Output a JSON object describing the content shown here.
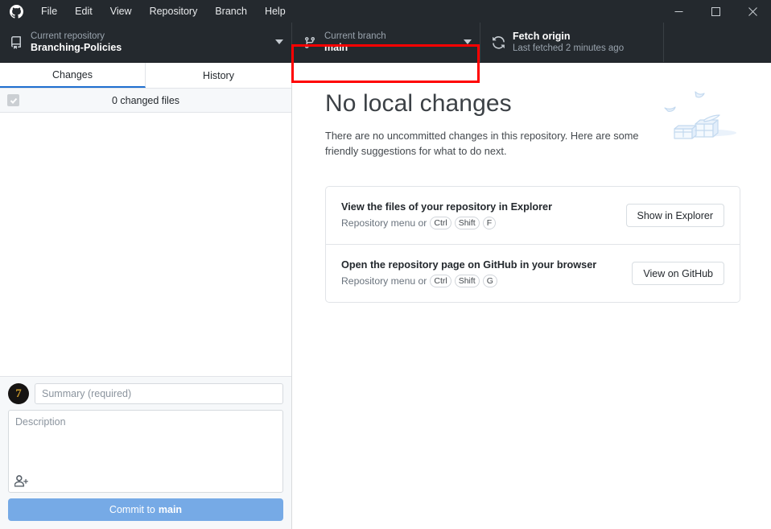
{
  "window": {
    "app_icon": "github-logo-icon",
    "menu": [
      {
        "label": "File"
      },
      {
        "label": "Edit"
      },
      {
        "label": "View"
      },
      {
        "label": "Repository"
      },
      {
        "label": "Branch"
      },
      {
        "label": "Help"
      }
    ],
    "controls": {
      "minimize": "minimize-icon",
      "maximize": "maximize-icon",
      "close": "close-icon"
    }
  },
  "toolbar": {
    "repository": {
      "icon": "repo-icon",
      "label": "Current repository",
      "value": "Branching-Policies",
      "caret": "chevron-down-icon"
    },
    "branch": {
      "icon": "branch-icon",
      "label": "Current branch",
      "value": "main",
      "caret": "chevron-down-icon",
      "highlighted": true,
      "highlight_color": "#ff0000"
    },
    "fetch": {
      "icon": "sync-icon",
      "label": "Fetch origin",
      "value": "Last fetched 2 minutes ago"
    }
  },
  "sidebar": {
    "tabs": [
      {
        "label": "Changes",
        "active": true
      },
      {
        "label": "History",
        "active": false
      }
    ],
    "changed_files_summary": "0 changed files",
    "checkbox_checked": true,
    "commit": {
      "avatar_initial": "7",
      "summary_placeholder": "Summary (required)",
      "summary_value": "",
      "description_placeholder": "Description",
      "description_value": "",
      "coauthor_icon": "add-person-icon",
      "button_prefix": "Commit to",
      "button_branch": "main"
    }
  },
  "main": {
    "title": "No local changes",
    "subtitle": "There are no uncommitted changes in this repository. Here are some friendly suggestions for what to do next.",
    "illustration": "boxes-illustration",
    "cards": [
      {
        "title": "View the files of your repository in Explorer",
        "hint_prefix": "Repository menu or",
        "keys": [
          "Ctrl",
          "Shift",
          "F"
        ],
        "button": "Show in Explorer"
      },
      {
        "title": "Open the repository page on GitHub in your browser",
        "hint_prefix": "Repository menu or",
        "keys": [
          "Ctrl",
          "Shift",
          "G"
        ],
        "button": "View on GitHub"
      }
    ]
  },
  "colors": {
    "titlebar_bg": "#24292e",
    "accent_blue": "#1f6fd0",
    "commit_button": "#76aae6",
    "highlight_red": "#ff0000"
  }
}
